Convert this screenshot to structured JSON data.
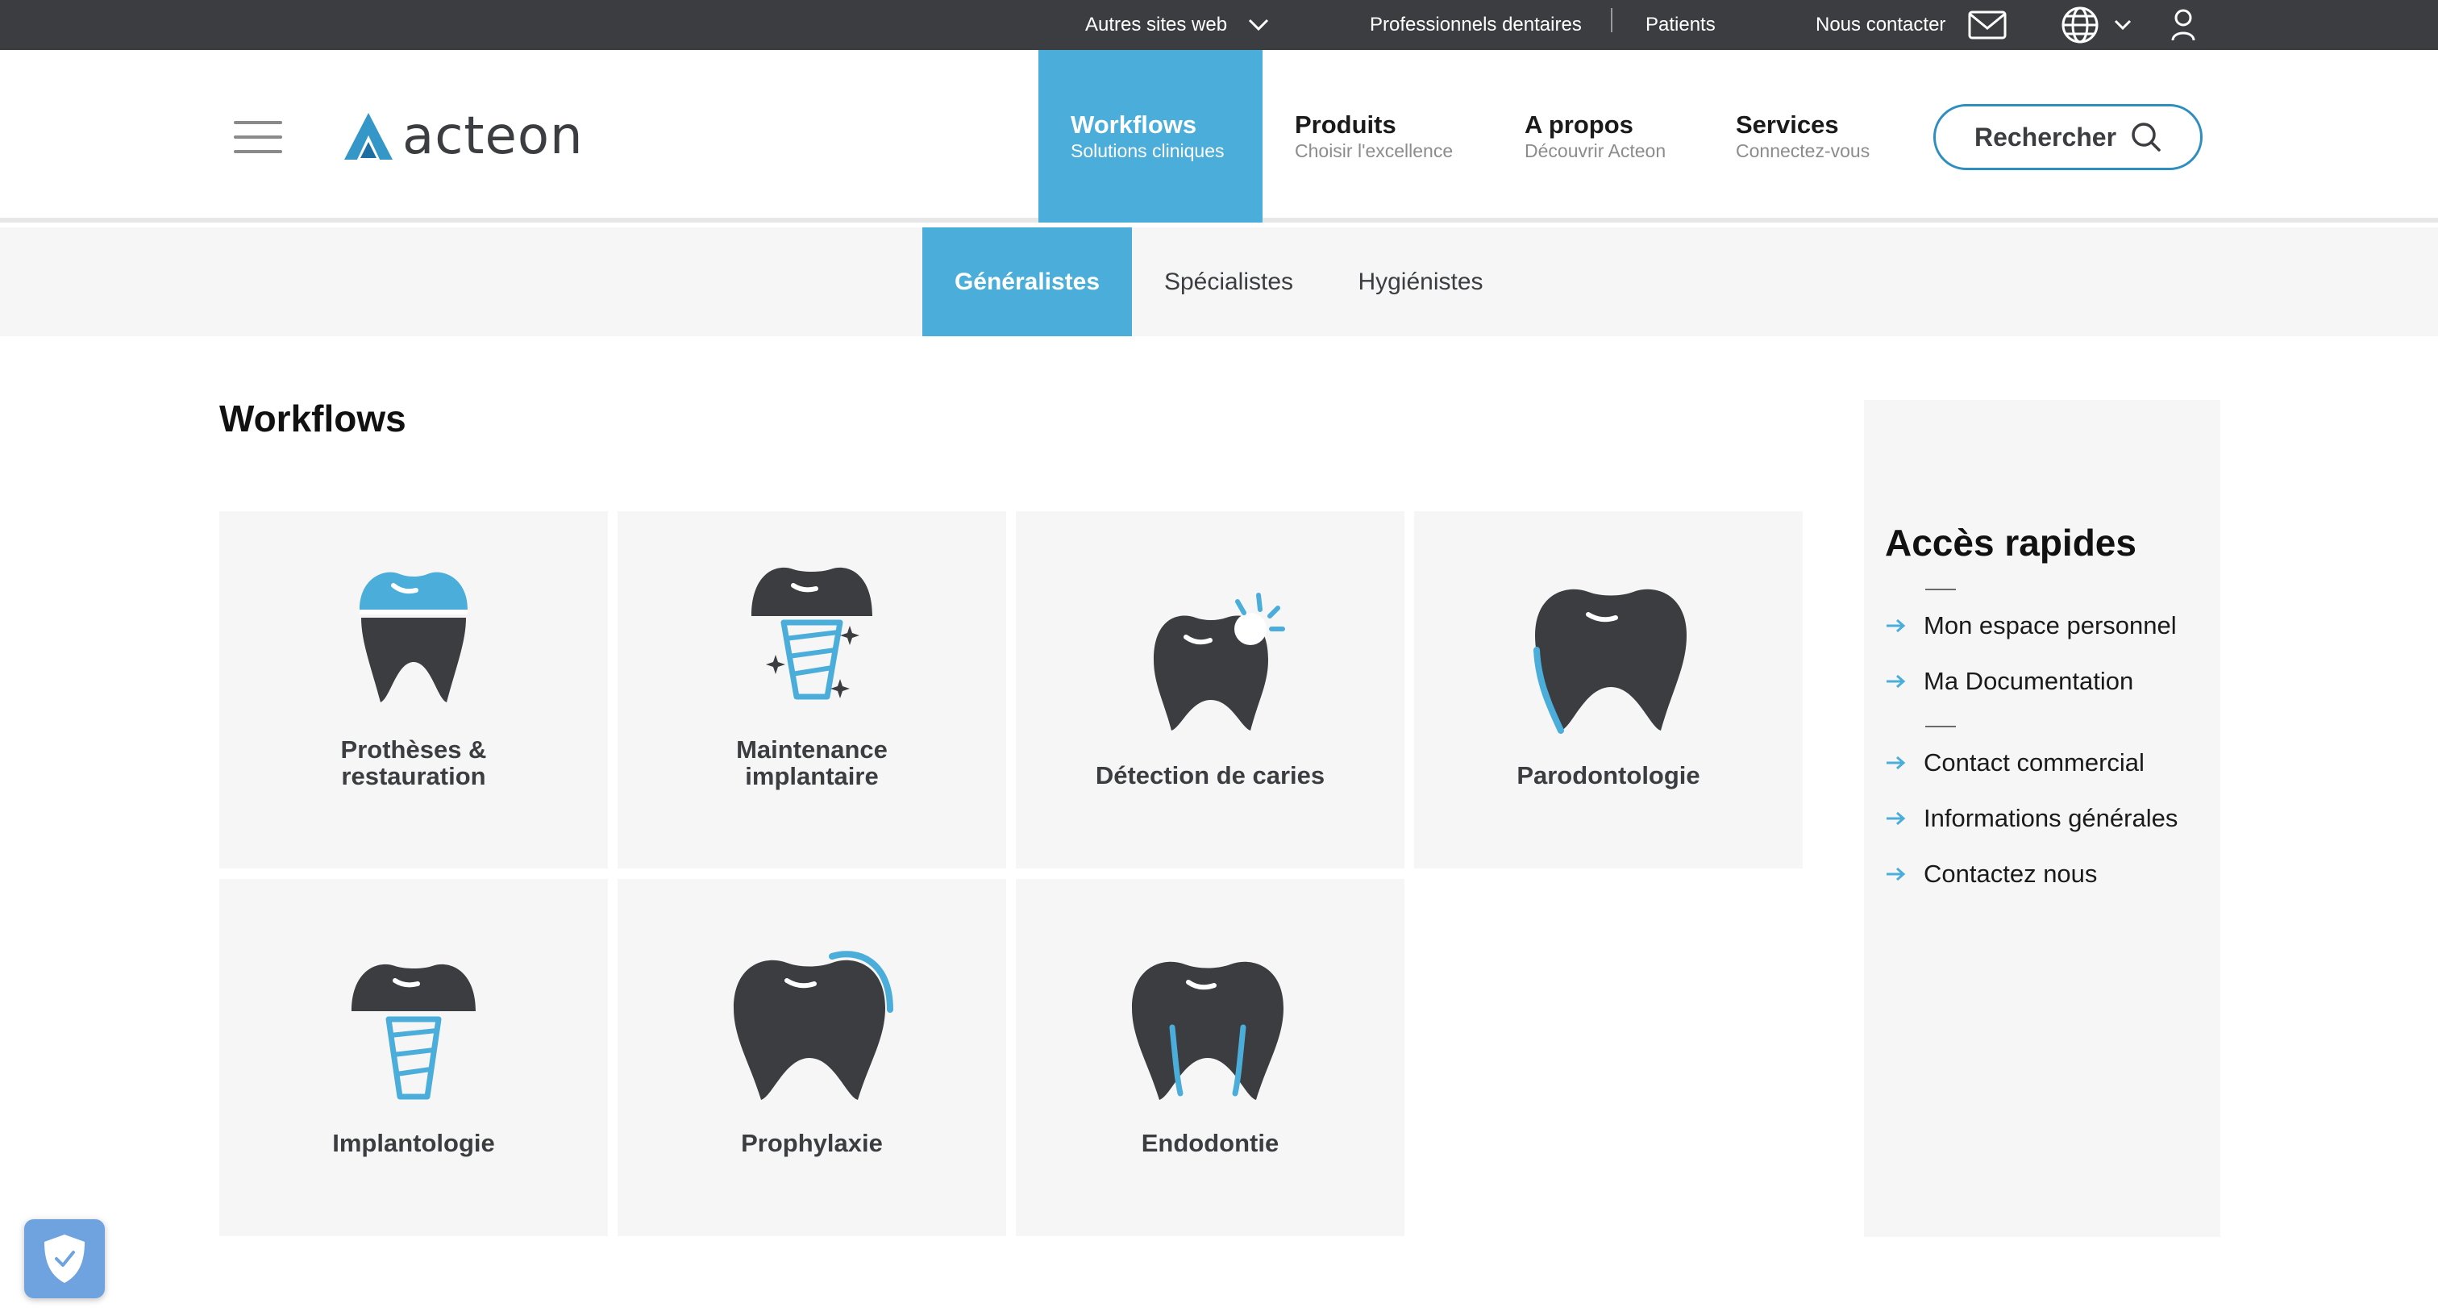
{
  "topbar": {
    "other_sites": "Autres sites web",
    "professionals": "Professionnels dentaires",
    "patients": "Patients",
    "contact": "Nous contacter"
  },
  "header": {
    "logo_text": "acteon",
    "nav": [
      {
        "title": "Workflows",
        "subtitle": "Solutions cliniques",
        "active": true
      },
      {
        "title": "Produits",
        "subtitle": "Choisir l'excellence"
      },
      {
        "title": "A propos",
        "subtitle": "Découvrir Acteon"
      },
      {
        "title": "Services",
        "subtitle": "Connectez-vous"
      }
    ],
    "search_label": "Rechercher"
  },
  "subnav": [
    "Généralistes",
    "Spécialistes",
    "Hygiénistes"
  ],
  "main": {
    "title": "Workflows",
    "cards": [
      {
        "line1": "Prothèses &",
        "line2": "restauration",
        "icon": "crown-tooth-icon"
      },
      {
        "line1": "Maintenance",
        "line2": "implantaire",
        "icon": "implant-sparkle-icon"
      },
      {
        "line1": "Détection de caries",
        "line2": "",
        "icon": "caries-tooth-icon"
      },
      {
        "line1": "Parodontologie",
        "line2": "",
        "icon": "gum-tooth-icon"
      },
      {
        "line1": "Implantologie",
        "line2": "",
        "icon": "implant-icon"
      },
      {
        "line1": "Prophylaxie",
        "line2": "",
        "icon": "prophylaxis-tooth-icon"
      },
      {
        "line1": "Endodontie",
        "line2": "",
        "icon": "root-canal-tooth-icon"
      }
    ]
  },
  "quick_access": {
    "title": "Accès rapides",
    "links": [
      "Mon espace personnel",
      "Ma Documentation",
      "Contact commercial",
      "Informations générales",
      "Contactez nous"
    ]
  },
  "colors": {
    "accent": "#4badd9",
    "dark": "#3b3d40",
    "topbar": "#3b3d40",
    "panel": "#f6f6f6"
  }
}
